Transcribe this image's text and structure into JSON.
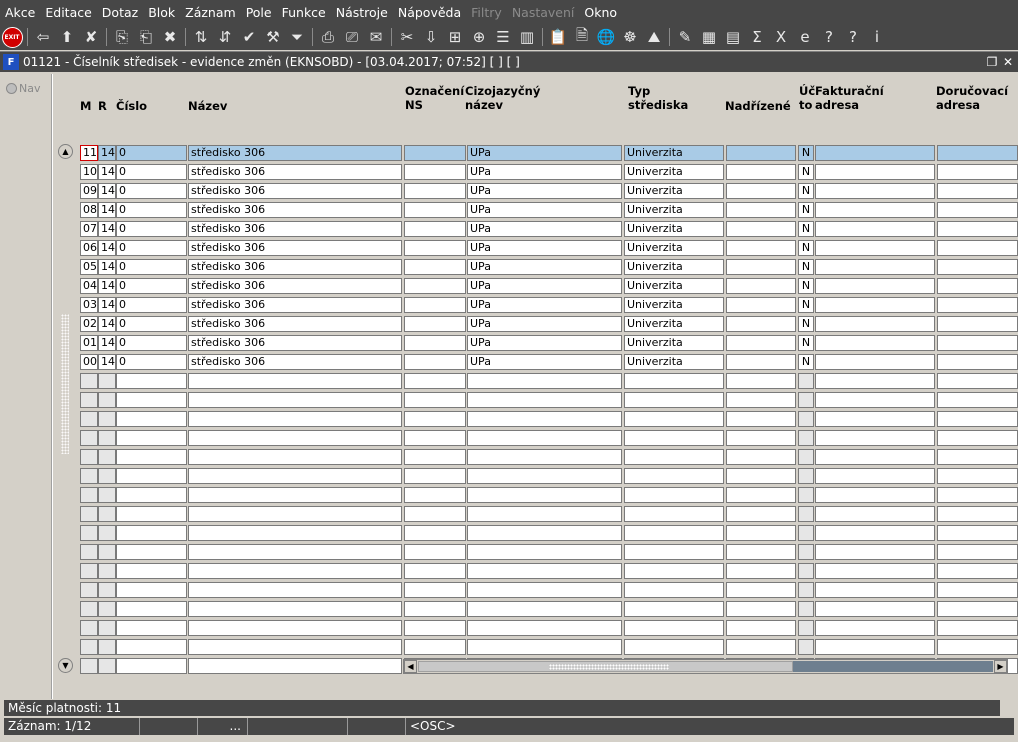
{
  "menu": [
    "Akce",
    "Editace",
    "Dotaz",
    "Blok",
    "Záznam",
    "Pole",
    "Funkce",
    "Nástroje",
    "Nápověda",
    "Filtry",
    "Nastavení",
    "Okno"
  ],
  "menu_disabled": [
    "Filtry",
    "Nastavení"
  ],
  "toolbar": {
    "exit_label": "EXIT",
    "icons": [
      {
        "name": "exit",
        "glyph": "EXIT"
      },
      {
        "name": "sep"
      },
      {
        "name": "new-record-icon",
        "glyph": "⇦"
      },
      {
        "name": "insert-record-icon",
        "glyph": "⬆"
      },
      {
        "name": "delete-record-icon",
        "glyph": "✘"
      },
      {
        "name": "sep"
      },
      {
        "name": "copy-record-icon",
        "glyph": "⎘"
      },
      {
        "name": "paste-record-icon",
        "glyph": "⎗"
      },
      {
        "name": "clear-record-icon",
        "glyph": "✖"
      },
      {
        "name": "sep"
      },
      {
        "name": "sort-ascending-icon",
        "glyph": "⇅"
      },
      {
        "name": "sort-descending-icon",
        "glyph": "⇵"
      },
      {
        "name": "commit-icon",
        "glyph": "✔"
      },
      {
        "name": "wrench-icon",
        "glyph": "⚒"
      },
      {
        "name": "filter-icon",
        "glyph": "⏷"
      },
      {
        "name": "sep"
      },
      {
        "name": "print-icon",
        "glyph": "⎙"
      },
      {
        "name": "print-preview-icon",
        "glyph": "⎚"
      },
      {
        "name": "mail-icon",
        "glyph": "✉"
      },
      {
        "name": "sep"
      },
      {
        "name": "cut-icon",
        "glyph": "✂"
      },
      {
        "name": "down-arrow-icon",
        "glyph": "⇩"
      },
      {
        "name": "tree-icon",
        "glyph": "⊞"
      },
      {
        "name": "lookup-icon",
        "glyph": "⊕"
      },
      {
        "name": "list-icon",
        "glyph": "☰"
      },
      {
        "name": "columns-icon",
        "glyph": "▥"
      },
      {
        "name": "sep"
      },
      {
        "name": "clipboard-icon",
        "glyph": "📋"
      },
      {
        "name": "document-icon",
        "glyph": "🗎"
      },
      {
        "name": "globe-icon",
        "glyph": "🌐"
      },
      {
        "name": "settings-wheel-icon",
        "glyph": "☸"
      },
      {
        "name": "mountain-icon",
        "glyph": "⛰"
      },
      {
        "name": "sep"
      },
      {
        "name": "edit-icon",
        "glyph": "✎"
      },
      {
        "name": "chart-icon",
        "glyph": "▦"
      },
      {
        "name": "calculator-icon",
        "glyph": "▤"
      },
      {
        "name": "sum-icon",
        "glyph": "Σ"
      },
      {
        "name": "excel-icon",
        "glyph": "X"
      },
      {
        "name": "internet-explorer-icon",
        "glyph": "e"
      },
      {
        "name": "help-context-icon",
        "glyph": "?"
      },
      {
        "name": "help-icon",
        "glyph": "?"
      },
      {
        "name": "info-icon",
        "glyph": "i"
      }
    ]
  },
  "window": {
    "icon_label": "F",
    "title": "01121 - Číselník středisek - evidence změn (EKNSOBD) - [03.04.2017; 07:52] [ ] [ ]"
  },
  "nav": {
    "label": "Nav"
  },
  "columns": {
    "m": "M",
    "r": "R",
    "cislo": "Číslo",
    "nazev": "Název",
    "oznaceni_1": "Označení",
    "oznaceni_2": "NS",
    "cizojazycny_1": "Cizojazyčný",
    "cizojazycny_2": "název",
    "typ_1": "Typ",
    "typ_2": "střediska",
    "nadrizene": "Nadřízené",
    "uc_1": "Úč",
    "uc_2": "to",
    "fakturacni_1": "Fakturační",
    "fakturacni_2": "adresa",
    "dorucovaci_1": "Doručovací",
    "dorucovaci_2": "adresa"
  },
  "rows": [
    {
      "m": "11",
      "r": "14",
      "cislo": "0",
      "nazev": "středisko 306",
      "oznaceni": "",
      "cizojazycny": "UPa",
      "typ": "Univerzita",
      "nadrizene": "",
      "uc": "N",
      "fakturacni": "",
      "dorucovaci": ""
    },
    {
      "m": "10",
      "r": "14",
      "cislo": "0",
      "nazev": "středisko 306",
      "oznaceni": "",
      "cizojazycny": "UPa",
      "typ": "Univerzita",
      "nadrizene": "",
      "uc": "N",
      "fakturacni": "",
      "dorucovaci": ""
    },
    {
      "m": "09",
      "r": "14",
      "cislo": "0",
      "nazev": "středisko 306",
      "oznaceni": "",
      "cizojazycny": "UPa",
      "typ": "Univerzita",
      "nadrizene": "",
      "uc": "N",
      "fakturacni": "",
      "dorucovaci": ""
    },
    {
      "m": "08",
      "r": "14",
      "cislo": "0",
      "nazev": "středisko 306",
      "oznaceni": "",
      "cizojazycny": "UPa",
      "typ": "Univerzita",
      "nadrizene": "",
      "uc": "N",
      "fakturacni": "",
      "dorucovaci": ""
    },
    {
      "m": "07",
      "r": "14",
      "cislo": "0",
      "nazev": "středisko 306",
      "oznaceni": "",
      "cizojazycny": "UPa",
      "typ": "Univerzita",
      "nadrizene": "",
      "uc": "N",
      "fakturacni": "",
      "dorucovaci": ""
    },
    {
      "m": "06",
      "r": "14",
      "cislo": "0",
      "nazev": "středisko 306",
      "oznaceni": "",
      "cizojazycny": "UPa",
      "typ": "Univerzita",
      "nadrizene": "",
      "uc": "N",
      "fakturacni": "",
      "dorucovaci": ""
    },
    {
      "m": "05",
      "r": "14",
      "cislo": "0",
      "nazev": "středisko 306",
      "oznaceni": "",
      "cizojazycny": "UPa",
      "typ": "Univerzita",
      "nadrizene": "",
      "uc": "N",
      "fakturacni": "",
      "dorucovaci": ""
    },
    {
      "m": "04",
      "r": "14",
      "cislo": "0",
      "nazev": "středisko 306",
      "oznaceni": "",
      "cizojazycny": "UPa",
      "typ": "Univerzita",
      "nadrizene": "",
      "uc": "N",
      "fakturacni": "",
      "dorucovaci": ""
    },
    {
      "m": "03",
      "r": "14",
      "cislo": "0",
      "nazev": "středisko 306",
      "oznaceni": "",
      "cizojazycny": "UPa",
      "typ": "Univerzita",
      "nadrizene": "",
      "uc": "N",
      "fakturacni": "",
      "dorucovaci": ""
    },
    {
      "m": "02",
      "r": "14",
      "cislo": "0",
      "nazev": "středisko 306",
      "oznaceni": "",
      "cizojazycny": "UPa",
      "typ": "Univerzita",
      "nadrizene": "",
      "uc": "N",
      "fakturacni": "",
      "dorucovaci": ""
    },
    {
      "m": "01",
      "r": "14",
      "cislo": "0",
      "nazev": "středisko 306",
      "oznaceni": "",
      "cizojazycny": "UPa",
      "typ": "Univerzita",
      "nadrizene": "",
      "uc": "N",
      "fakturacni": "",
      "dorucovaci": ""
    },
    {
      "m": "00",
      "r": "14",
      "cislo": "0",
      "nazev": "středisko 306",
      "oznaceni": "",
      "cizojazycny": "UPa",
      "typ": "Univerzita",
      "nadrizene": "",
      "uc": "N",
      "fakturacni": "",
      "dorucovaci": ""
    }
  ],
  "empty_rows": 16,
  "status": {
    "line1": "Měsíc platnosti: 11",
    "record": "Záznam: 1/12",
    "seg2": "",
    "seg3": "...",
    "seg4": "",
    "seg5": "",
    "mode": "<OSC>"
  },
  "colors": {
    "dark_bar": "#474747",
    "current_row": "#a9cbe6",
    "current_cell_border": "#d00000"
  }
}
